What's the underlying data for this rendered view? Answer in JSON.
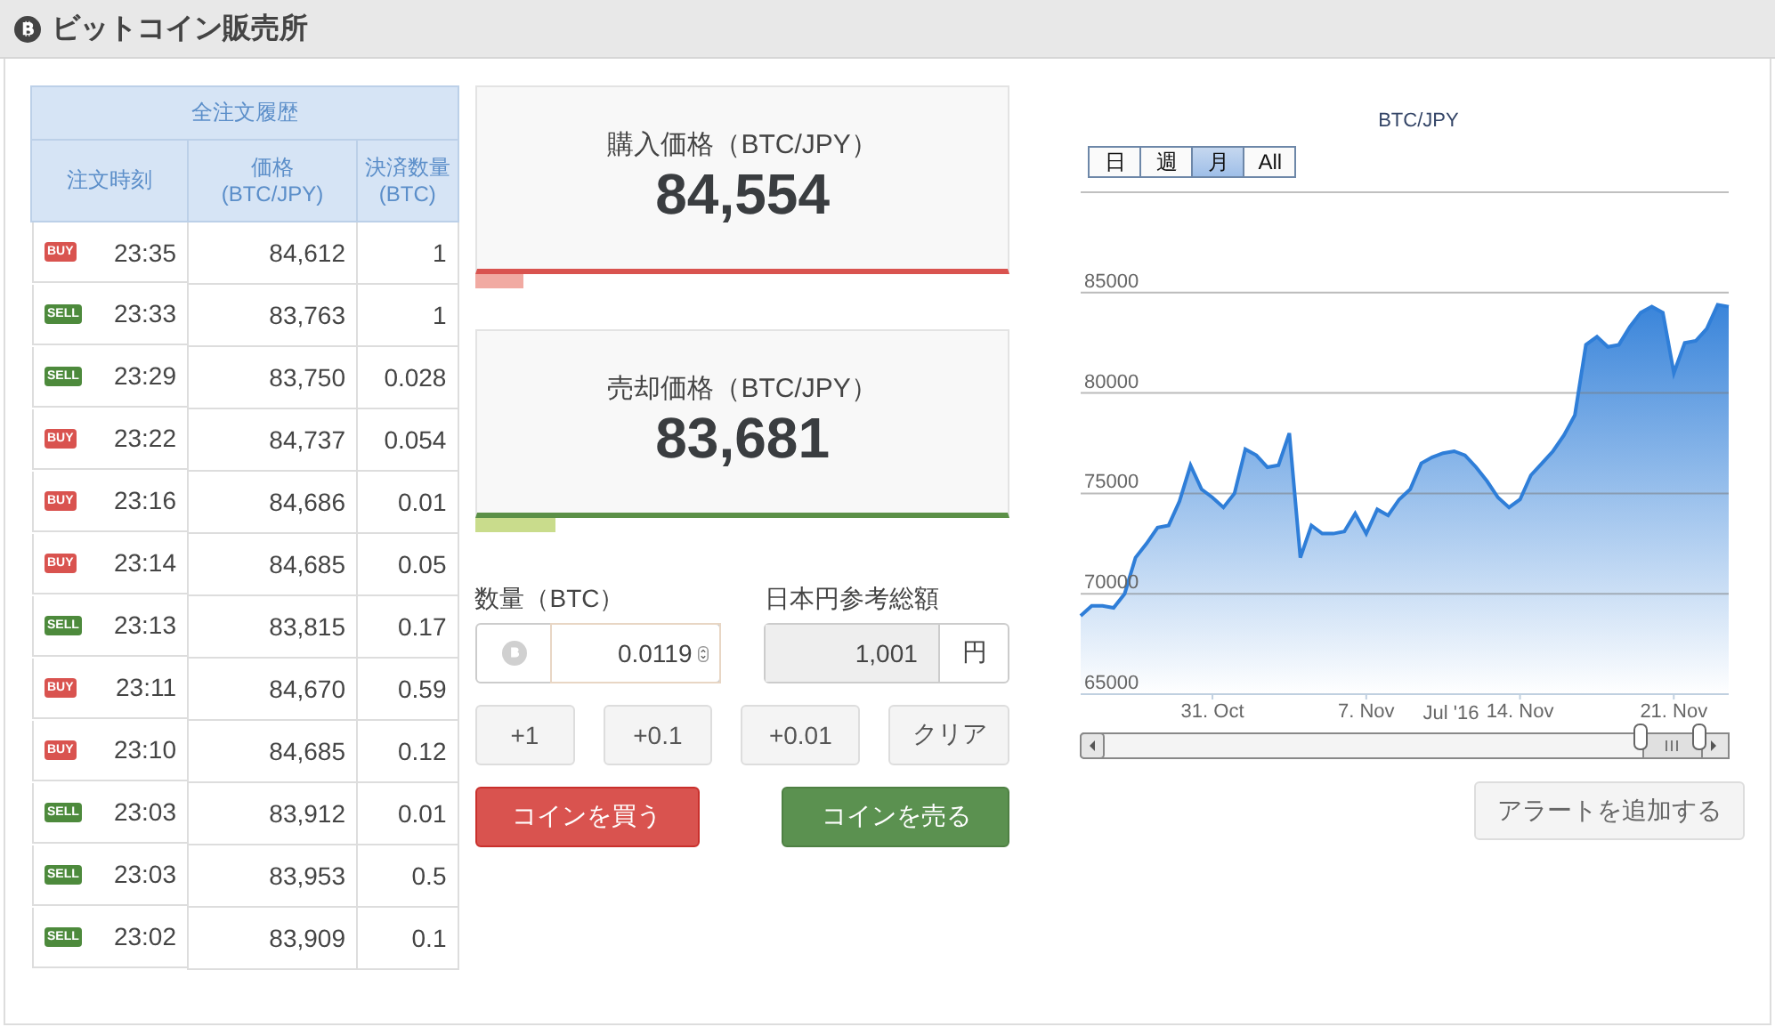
{
  "header": {
    "title": "ビットコイン販売所"
  },
  "order_history": {
    "title": "全注文履歴",
    "columns": [
      {
        "label": "注文時刻"
      },
      {
        "label": "価格",
        "unit": "(BTC/JPY)"
      },
      {
        "label": "決済数量",
        "unit": "(BTC)"
      }
    ],
    "rows": [
      {
        "kind": "buy",
        "badge": "BUY",
        "time": "23:35",
        "price": "84,612",
        "amount": "1"
      },
      {
        "kind": "sell",
        "badge": "SELL",
        "time": "23:33",
        "price": "83,763",
        "amount": "1"
      },
      {
        "kind": "sell",
        "badge": "SELL",
        "time": "23:29",
        "price": "83,750",
        "amount": "0.028"
      },
      {
        "kind": "buy",
        "badge": "BUY",
        "time": "23:22",
        "price": "84,737",
        "amount": "0.054"
      },
      {
        "kind": "buy",
        "badge": "BUY",
        "time": "23:16",
        "price": "84,686",
        "amount": "0.01"
      },
      {
        "kind": "buy",
        "badge": "BUY",
        "time": "23:14",
        "price": "84,685",
        "amount": "0.05"
      },
      {
        "kind": "sell",
        "badge": "SELL",
        "time": "23:13",
        "price": "83,815",
        "amount": "0.17"
      },
      {
        "kind": "buy",
        "badge": "BUY",
        "time": "23:11",
        "price": "84,670",
        "amount": "0.59"
      },
      {
        "kind": "buy",
        "badge": "BUY",
        "time": "23:10",
        "price": "84,685",
        "amount": "0.12"
      },
      {
        "kind": "sell",
        "badge": "SELL",
        "time": "23:03",
        "price": "83,912",
        "amount": "0.01"
      },
      {
        "kind": "sell",
        "badge": "SELL",
        "time": "23:03",
        "price": "83,953",
        "amount": "0.5"
      },
      {
        "kind": "sell",
        "badge": "SELL",
        "time": "23:02",
        "price": "83,909",
        "amount": "0.1"
      }
    ]
  },
  "prices": [
    {
      "kind": "buy",
      "label": "購入価格（BTC/JPY）",
      "price": "84,554",
      "level": 0.09
    },
    {
      "kind": "sell",
      "label": "売却価格（BTC/JPY）",
      "price": "83,681",
      "level": 0.15
    }
  ],
  "order_form": {
    "quantity_label": "数量（BTC）",
    "quantity_value": "0.0119",
    "total_label": "日本円参考総額",
    "total_value": "1,001",
    "total_unit": "円",
    "quick_buttons": [
      "+1",
      "+0.1",
      "+0.01",
      "クリア"
    ],
    "buy_button": "コインを買う",
    "sell_button": "コインを売る"
  },
  "chart": {
    "ranges": [
      {
        "label": "日",
        "selected": false
      },
      {
        "label": "週",
        "selected": false
      },
      {
        "label": "月",
        "selected": true
      },
      {
        "label": "All",
        "selected": false
      }
    ],
    "chart_data": {
      "type": "area",
      "title": "BTC/JPY",
      "categories": [
        null,
        null,
        null,
        null,
        null,
        null,
        null,
        null,
        null,
        null,
        null,
        null,
        "31. Oct",
        null,
        null,
        null,
        null,
        null,
        null,
        null,
        null,
        null,
        null,
        null,
        null,
        null,
        "7. Nov",
        null,
        null,
        null,
        null,
        null,
        null,
        null,
        null,
        null,
        null,
        null,
        null,
        null,
        "14. Nov",
        null,
        null,
        null,
        null,
        null,
        null,
        null,
        null,
        null,
        null,
        null,
        null,
        null,
        "21. Nov",
        null,
        null,
        null,
        null,
        null
      ],
      "series": [
        {
          "color": "#2f7ed8",
          "values": [
            68900,
            69400,
            69400,
            69300,
            70000,
            71800,
            72500,
            73300,
            73400,
            74600,
            76400,
            75200,
            74800,
            74300,
            75000,
            77200,
            76900,
            76300,
            76400,
            78000,
            71800,
            73400,
            73000,
            73000,
            73100,
            74000,
            73000,
            74200,
            73900,
            74700,
            75200,
            76500,
            76800,
            77000,
            77100,
            76900,
            76300,
            75600,
            74800,
            74300,
            74700,
            75900,
            76500,
            77100,
            77900,
            78900,
            82400,
            82800,
            82300,
            82400,
            83300,
            84000,
            84300,
            84000,
            81000,
            82500,
            82600,
            83200,
            84400,
            84300
          ]
        }
      ],
      "ylim": [
        65000,
        90000
      ],
      "grid": true,
      "yticks": [
        65000,
        70000,
        75000,
        80000,
        85000
      ]
    },
    "navigator_label": "Jul '16"
  },
  "alert_button": "アラートを追加する"
}
